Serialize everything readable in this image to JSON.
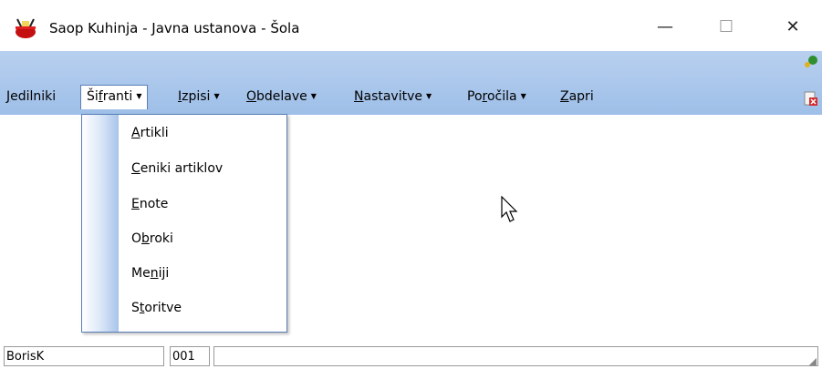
{
  "window": {
    "title": "Saop Kuhinja - Javna ustanova - Šola",
    "minimize_glyph": "—",
    "maximize_glyph": "☐",
    "close_glyph": "✕",
    "app_icon": "red-cooking-pot-icon"
  },
  "menubar": {
    "items": [
      {
        "pre": "",
        "accel": "J",
        "post": "edilniki",
        "has_arrow": false
      },
      {
        "pre": "Ši",
        "accel": "f",
        "post": "ranti",
        "has_arrow": true
      },
      {
        "pre": "",
        "accel": "I",
        "post": "zpisi",
        "has_arrow": true
      },
      {
        "pre": "",
        "accel": "O",
        "post": "bdelave",
        "has_arrow": true
      },
      {
        "pre": "",
        "accel": "N",
        "post": "astavitve",
        "has_arrow": true
      },
      {
        "pre": "Po",
        "accel": "r",
        "post": "očila",
        "has_arrow": true
      },
      {
        "pre": "",
        "accel": "Z",
        "post": "apri",
        "has_arrow": false
      }
    ],
    "right_icons": [
      "green-key-icon",
      "close-document-icon"
    ]
  },
  "dropdown": {
    "items": [
      {
        "pre": "",
        "accel": "A",
        "post": "rtikli"
      },
      {
        "pre": "",
        "accel": "C",
        "post": "eniki artiklov"
      },
      {
        "pre": "",
        "accel": "E",
        "post": "note"
      },
      {
        "pre": "O",
        "accel": "b",
        "post": "roki"
      },
      {
        "pre": "Me",
        "accel": "n",
        "post": "iji"
      },
      {
        "pre": "S",
        "accel": "t",
        "post": "oritve"
      }
    ]
  },
  "statusbar": {
    "user": "BorisK",
    "code": "001",
    "message": ""
  },
  "colors": {
    "menubar": "#a8c6ec",
    "dropdown_border": "#5a7fb5"
  }
}
